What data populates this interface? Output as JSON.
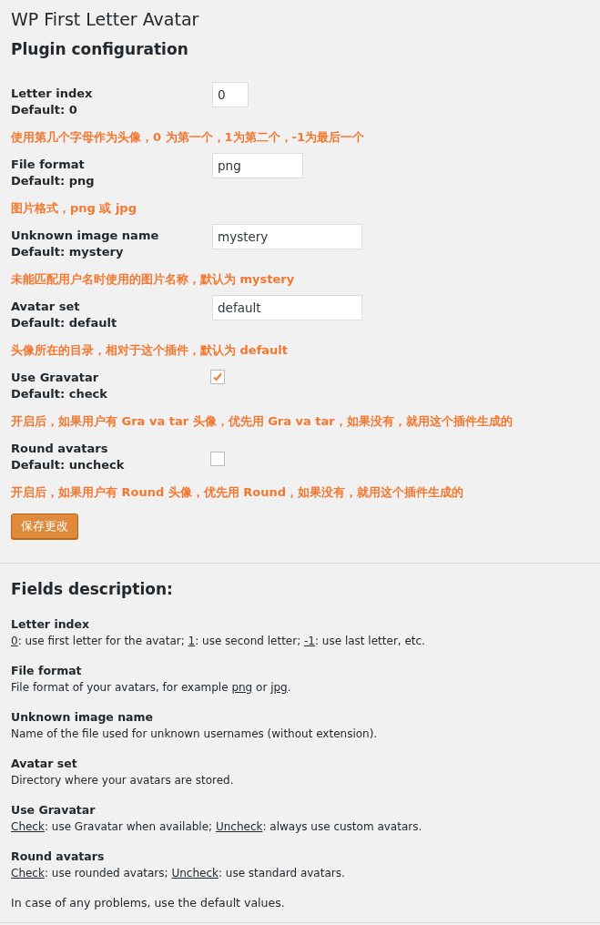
{
  "page_title": "WP First Letter Avatar",
  "config": {
    "heading": "Plugin configuration",
    "fields": [
      {
        "label": "Letter index",
        "default": "Default: 0",
        "kind": "text",
        "value": "0",
        "note": "使用第几个字母作为头像，0 为第一个，1为第二个，-1为最后一个"
      },
      {
        "label": "File format",
        "default": "Default: png",
        "kind": "text",
        "value": "png",
        "note": "图片格式，png 或 jpg"
      },
      {
        "label": "Unknown image name",
        "default": "Default: mystery",
        "kind": "text",
        "value": "mystery",
        "note": "未能匹配用户名时使用的图片名称，默认为 mystery"
      },
      {
        "label": "Avatar set",
        "default": "Default: default",
        "kind": "text",
        "value": "default",
        "note": "头像所在的目录，相对于这个插件，默认为 default"
      },
      {
        "label": "Use Gravatar",
        "default": "Default: check",
        "kind": "checkbox",
        "checked": true,
        "note": "开启后，如果用户有 Gra va tar 头像，优先用 Gra va tar，如果没有，就用这个插件生成的"
      },
      {
        "label": "Round avatars",
        "default": "Default: uncheck",
        "kind": "checkbox",
        "checked": false,
        "note": "开启后，如果用户有 Round 头像，优先用 Round，如果没有，就用这个插件生成的"
      }
    ],
    "save_button": "保存更改"
  },
  "description": {
    "heading": "Fields description:",
    "items": [
      {
        "title": "Letter index",
        "parts": [
          {
            "text": "0",
            "underlined": true
          },
          {
            "text": ": use first letter for the avatar; ",
            "underlined": false
          },
          {
            "text": "1",
            "underlined": true
          },
          {
            "text": ": use second letter; ",
            "underlined": false
          },
          {
            "text": "-1",
            "underlined": true
          },
          {
            "text": ": use last letter, etc.",
            "underlined": false
          }
        ]
      },
      {
        "title": "File format",
        "parts": [
          {
            "text": "File format of your avatars, for example ",
            "underlined": false
          },
          {
            "text": "png",
            "underlined": true
          },
          {
            "text": " or ",
            "underlined": false
          },
          {
            "text": "jpg",
            "underlined": true
          },
          {
            "text": ".",
            "underlined": false
          }
        ]
      },
      {
        "title": "Unknown image name",
        "parts": [
          {
            "text": "Name of the file used for unknown usernames (without extension).",
            "underlined": false
          }
        ]
      },
      {
        "title": "Avatar set",
        "parts": [
          {
            "text": "Directory where your avatars are stored.",
            "underlined": false
          }
        ]
      },
      {
        "title": "Use Gravatar",
        "parts": [
          {
            "text": "Check",
            "underlined": true
          },
          {
            "text": ": use Gravatar when available; ",
            "underlined": false
          },
          {
            "text": "Uncheck",
            "underlined": true
          },
          {
            "text": ": always use custom avatars.",
            "underlined": false
          }
        ]
      },
      {
        "title": "Round avatars",
        "parts": [
          {
            "text": "Check",
            "underlined": true
          },
          {
            "text": ": use rounded avatars; ",
            "underlined": false
          },
          {
            "text": "Uncheck",
            "underlined": true
          },
          {
            "text": ": use standard avatars.",
            "underlined": false
          }
        ]
      }
    ],
    "footer": "In case of any problems, use the default values."
  }
}
